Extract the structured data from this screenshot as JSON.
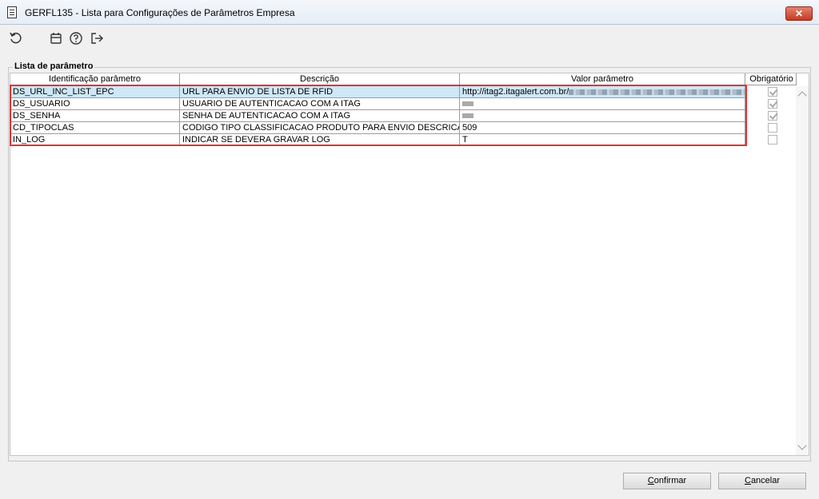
{
  "window": {
    "title": "GERFL135 - Lista para Configurações de Parâmetros Empresa",
    "close_label": "✕"
  },
  "toolbar": {
    "icons": [
      "refresh-icon",
      "calendar-icon",
      "help-icon",
      "exit-icon"
    ]
  },
  "group": {
    "label": "Lista de parâmetro"
  },
  "grid": {
    "columns": [
      "Identificação parâmetro",
      "Descrição",
      "Valor parâmetro",
      "Obrigatório"
    ],
    "rows": [
      {
        "id": "DS_URL_INC_LIST_EPC",
        "desc": "URL PARA ENVIO DE LISTA DE RFID",
        "value": "http://itag2.itagalert.com.br/",
        "required": true
      },
      {
        "id": "DS_USUARIO",
        "desc": "USUARIO DE AUTENTICACAO COM A ITAG",
        "value": "",
        "required": true
      },
      {
        "id": "DS_SENHA",
        "desc": "SENHA DE AUTENTICACAO COM A ITAG",
        "value": "",
        "required": true
      },
      {
        "id": "CD_TIPOCLAS",
        "desc": "CODIGO TIPO CLASSIFICACAO PRODUTO PARA ENVIO DESCRICAO DA",
        "value": "509",
        "required": false
      },
      {
        "id": "IN_LOG",
        "desc": "INDICAR SE DEVERA GRAVAR LOG",
        "value": "T",
        "required": false
      }
    ]
  },
  "buttons": {
    "confirm": {
      "first": "C",
      "rest": "onfirmar"
    },
    "cancel": {
      "first": "C",
      "rest": "ancelar"
    }
  },
  "colors": {
    "selection": "#cde8f7",
    "highlight_border": "#e53030"
  }
}
